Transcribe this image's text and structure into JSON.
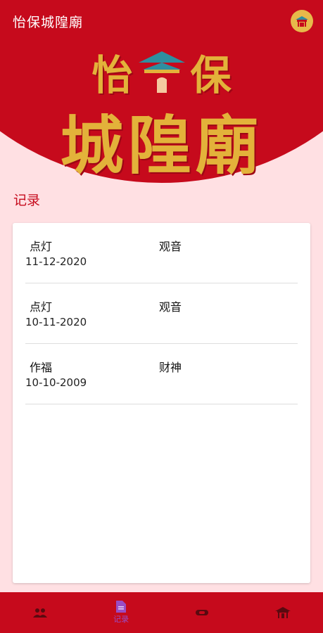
{
  "header": {
    "title": "怡保城隍廟"
  },
  "banner": {
    "line1_left": "怡",
    "line1_right": "保",
    "line2": "城隍廟"
  },
  "section": {
    "title": "记录"
  },
  "records": [
    {
      "type": "点灯",
      "deity": "观音",
      "date": "11-12-2020"
    },
    {
      "type": "点灯",
      "deity": "观音",
      "date": "10-11-2020"
    },
    {
      "type": "作福",
      "deity": "财神",
      "date": "10-10-2009"
    }
  ],
  "nav": {
    "items": [
      {
        "icon": "people-icon",
        "label": ""
      },
      {
        "icon": "records-icon",
        "label": "记录"
      },
      {
        "icon": "lantern-icon",
        "label": ""
      },
      {
        "icon": "temple-icon",
        "label": ""
      }
    ],
    "active_index": 1
  },
  "colors": {
    "primary_red": "#c60a1c",
    "gold": "#e3b23a",
    "background": "#ffe0e3",
    "active_nav": "#9a4cc4"
  }
}
